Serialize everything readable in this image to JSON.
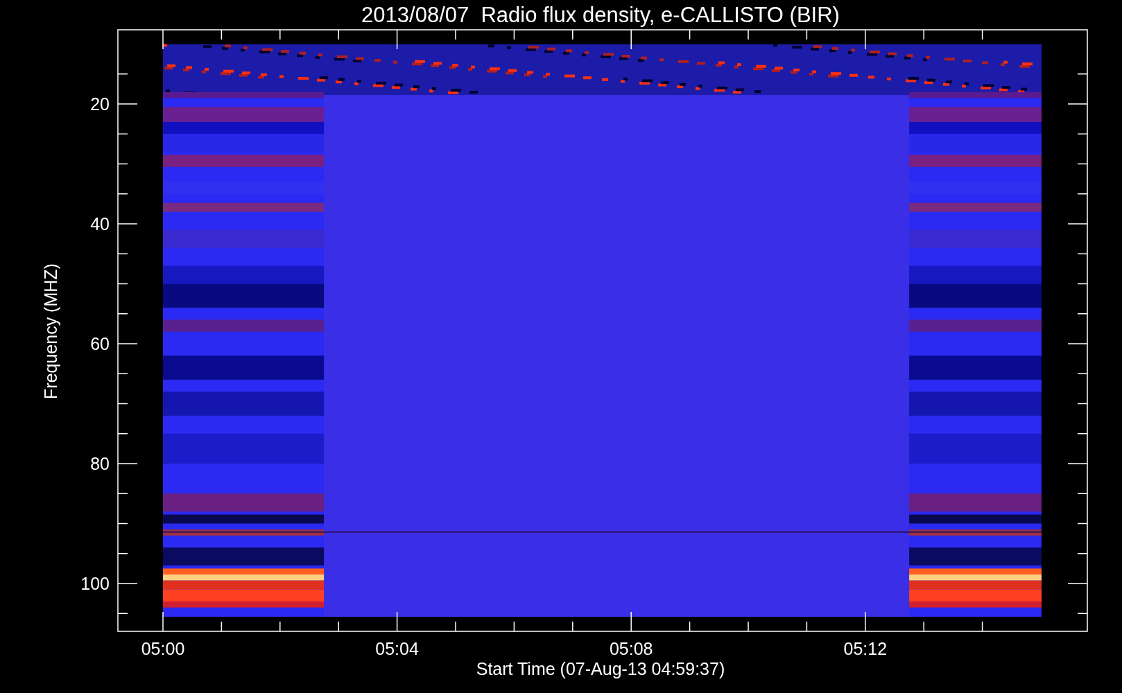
{
  "title": "2013/08/07  Radio flux density, e-CALLISTO (BIR)",
  "y_axis": {
    "label": "Frequency (MHZ)",
    "ticks": [
      "20",
      "40",
      "60",
      "80",
      "100"
    ]
  },
  "x_axis": {
    "label": "Start Time (07-Aug-13 04:59:37)",
    "ticks": [
      "05:00",
      "05:04",
      "05:08",
      "05:12"
    ]
  }
}
